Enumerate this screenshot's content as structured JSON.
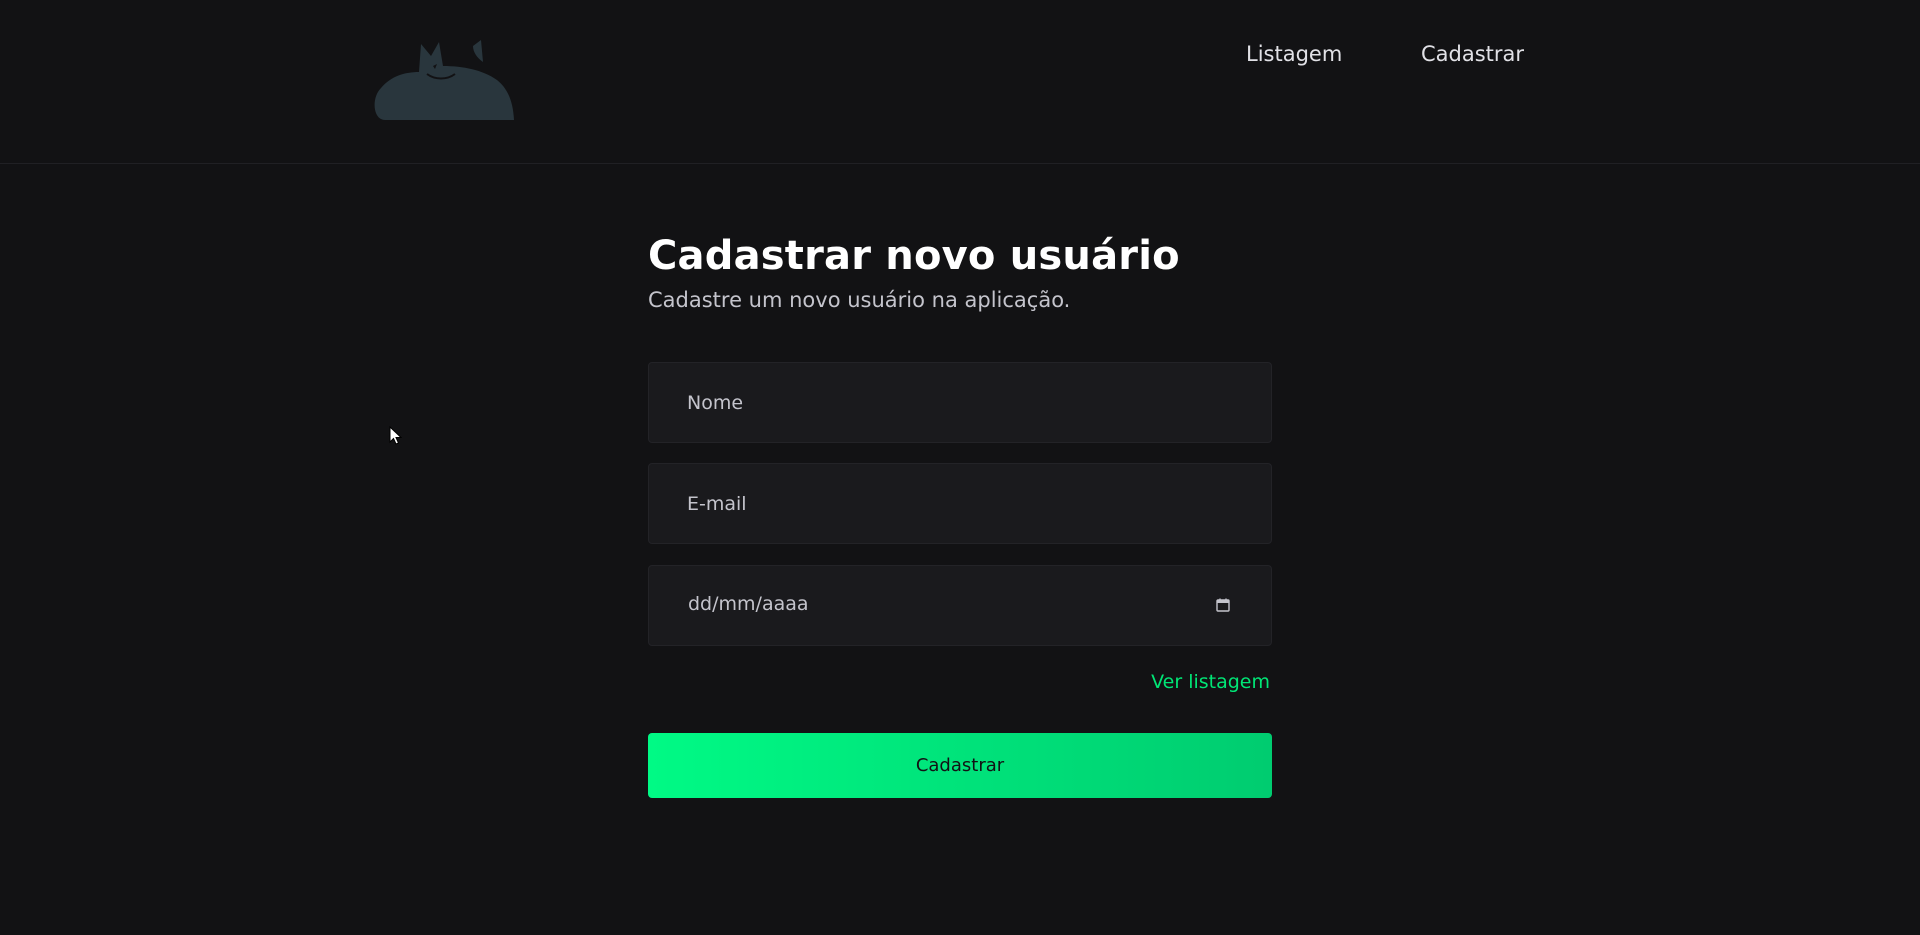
{
  "header": {
    "nav": {
      "list_label": "Listagem",
      "register_label": "Cadastrar"
    },
    "logo_icon": "sleeping-cat-logo"
  },
  "main": {
    "title": "Cadastrar novo usuário",
    "subtitle": "Cadastre um novo usuário na aplicação."
  },
  "form": {
    "name_placeholder": "Nome",
    "email_placeholder": "E-mail",
    "date_placeholder": "dd/mm/aaaa",
    "date_icon": "calendar-icon",
    "view_list_label": "Ver listagem",
    "submit_label": "Cadastrar"
  },
  "colors": {
    "background": "#121214",
    "field_background": "#1a1a1d",
    "accent": "#00e676",
    "logo": "#29363d"
  }
}
